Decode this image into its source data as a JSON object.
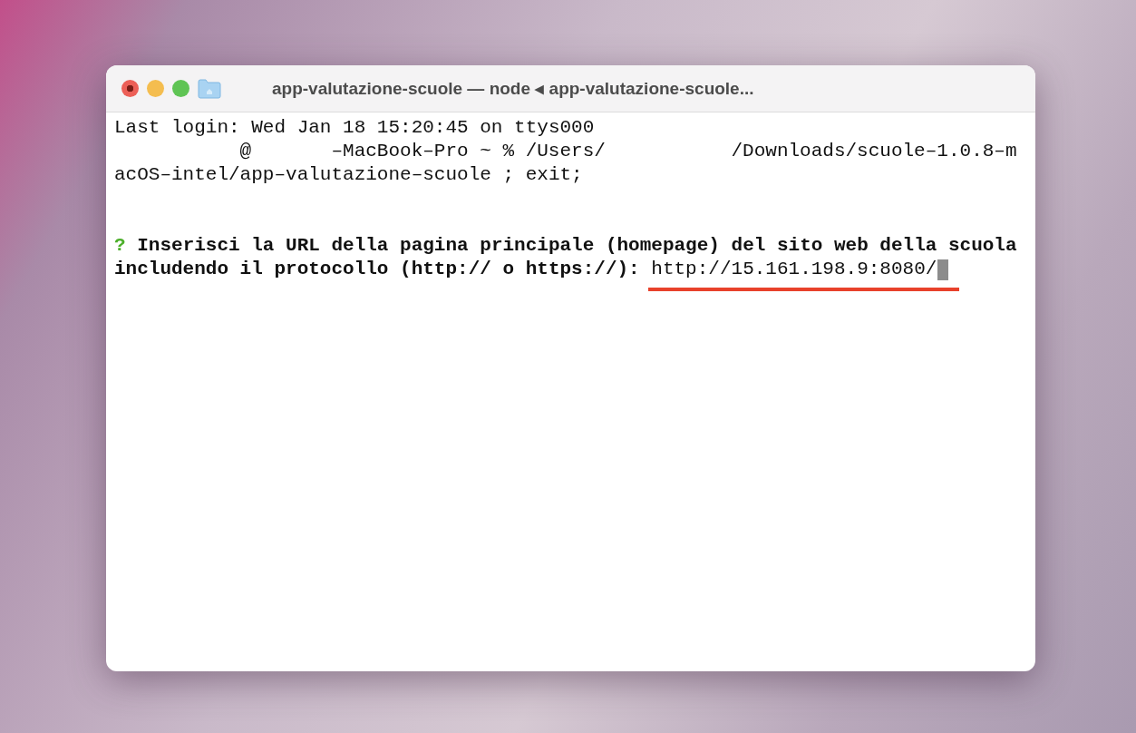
{
  "window": {
    "title": "app-valutazione-scuole — node ◂ app-valutazione-scuole..."
  },
  "terminal": {
    "lines": [
      {
        "kind": "plain",
        "segments": [
          "Last login: Wed Jan 18 15:20:45 on ttys000"
        ]
      },
      {
        "kind": "redacted",
        "segments": [
          "@",
          "–MacBook–Pro ~ % /Users/",
          "/Downloads/scuole–1.0.8–m"
        ]
      },
      {
        "kind": "plain",
        "segments": [
          "acOS–intel/app–valutazione–scuole ; exit;"
        ]
      },
      {
        "kind": "blank"
      },
      {
        "kind": "blank"
      },
      {
        "kind": "question",
        "mark": "?",
        "segments": [
          "Inserisci la URL della pagina principale (homepage) del sito web della scuola"
        ]
      },
      {
        "kind": "input",
        "prompt": "includendo il protocollo (http:// o https://):",
        "value": "http://15.161.198.9:8080/",
        "underlined": true,
        "cursor": true
      }
    ]
  }
}
